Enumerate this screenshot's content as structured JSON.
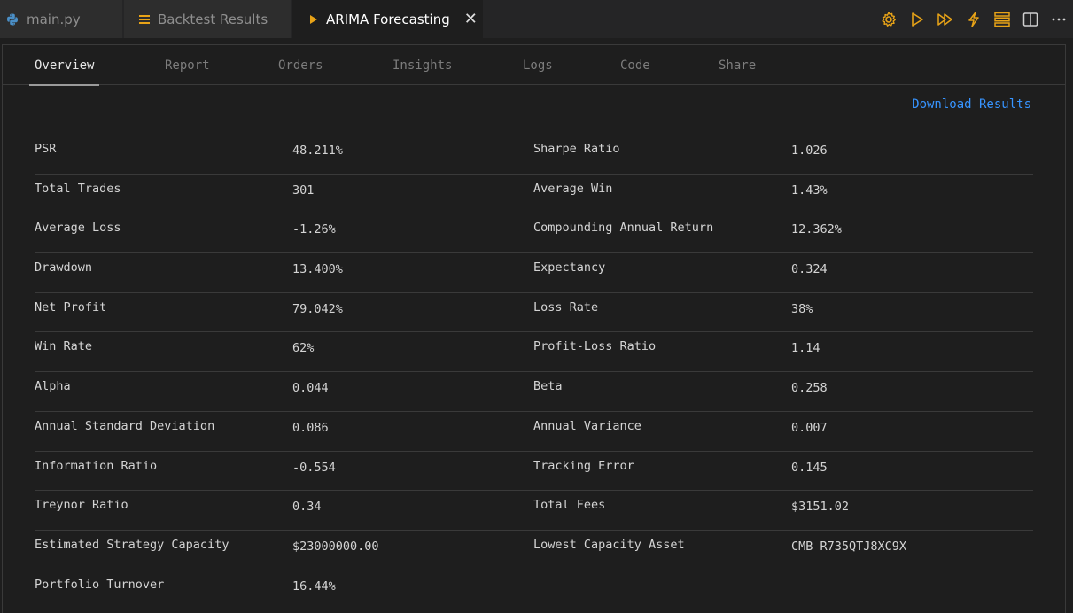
{
  "tabs": [
    {
      "label": "main.py",
      "icon": "python-icon"
    },
    {
      "label": "Backtest Results",
      "icon": "list-icon"
    },
    {
      "label": "ARIMA Forecasting",
      "icon": "play-triangle-icon"
    }
  ],
  "actions": [
    "gear-icon",
    "run-icon",
    "run-all-icon",
    "lightning-icon",
    "stack-icon",
    "split-editor-icon",
    "more-icon"
  ],
  "subtabs": [
    "Overview",
    "Report",
    "Orders",
    "Insights",
    "Logs",
    "Code",
    "Share"
  ],
  "download_label": "Download Results",
  "stats": [
    {
      "left": {
        "label": "PSR",
        "value": "48.211%"
      },
      "right": {
        "label": "Sharpe Ratio",
        "value": "1.026"
      }
    },
    {
      "left": {
        "label": "Total Trades",
        "value": "301"
      },
      "right": {
        "label": "Average Win",
        "value": "1.43%"
      }
    },
    {
      "left": {
        "label": "Average Loss",
        "value": "-1.26%"
      },
      "right": {
        "label": "Compounding Annual Return",
        "value": "12.362%"
      }
    },
    {
      "left": {
        "label": "Drawdown",
        "value": "13.400%"
      },
      "right": {
        "label": "Expectancy",
        "value": "0.324"
      }
    },
    {
      "left": {
        "label": "Net Profit",
        "value": "79.042%"
      },
      "right": {
        "label": "Loss Rate",
        "value": "38%"
      }
    },
    {
      "left": {
        "label": "Win Rate",
        "value": "62%"
      },
      "right": {
        "label": "Profit-Loss Ratio",
        "value": "1.14"
      }
    },
    {
      "left": {
        "label": "Alpha",
        "value": "0.044"
      },
      "right": {
        "label": "Beta",
        "value": "0.258"
      }
    },
    {
      "left": {
        "label": "Annual Standard Deviation",
        "value": "0.086"
      },
      "right": {
        "label": "Annual Variance",
        "value": "0.007"
      }
    },
    {
      "left": {
        "label": "Information Ratio",
        "value": "-0.554"
      },
      "right": {
        "label": "Tracking Error",
        "value": "0.145"
      }
    },
    {
      "left": {
        "label": "Treynor Ratio",
        "value": "0.34"
      },
      "right": {
        "label": "Total Fees",
        "value": "$3151.02"
      }
    },
    {
      "left": {
        "label": "Estimated Strategy Capacity",
        "value": "$23000000.00"
      },
      "right": {
        "label": "Lowest Capacity Asset",
        "value": "CMB R735QTJ8XC9X"
      }
    },
    {
      "left": {
        "label": "Portfolio Turnover",
        "value": "16.44%"
      },
      "right": null
    }
  ],
  "colors": {
    "accent": "#e8a317",
    "link": "#3794ff",
    "background": "#1e1e1e",
    "tabbar": "#252526"
  }
}
